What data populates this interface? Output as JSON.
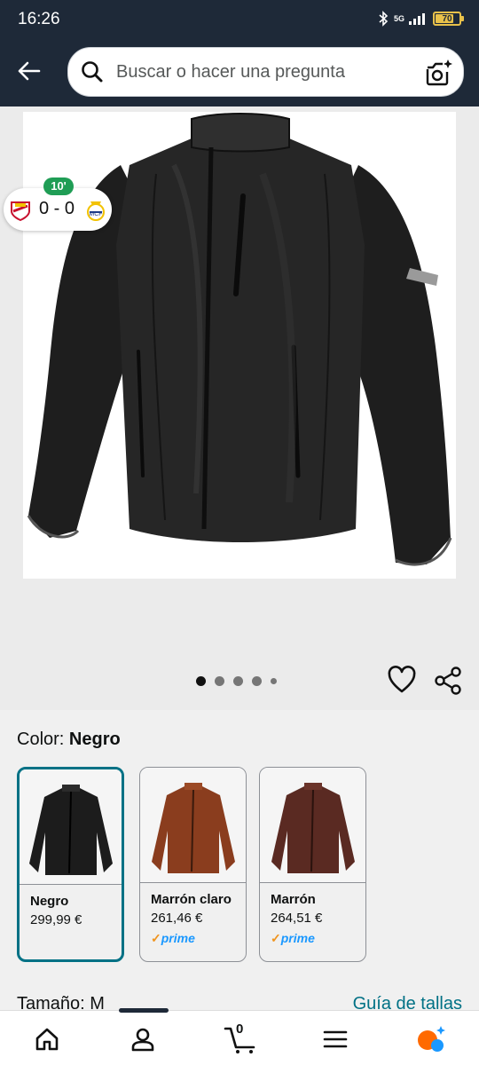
{
  "status_bar": {
    "time": "16:26",
    "network": "5G",
    "battery": "70"
  },
  "search": {
    "placeholder": "Buscar o hacer una pregunta"
  },
  "score_widget": {
    "minute": "10'",
    "score": "0 - 0"
  },
  "gallery": {
    "image_count": 5,
    "active_index": 0
  },
  "variations": {
    "color_prefix": "Color: ",
    "color_value": "Negro",
    "options": [
      {
        "name": "Negro",
        "price": "299,99 €",
        "prime": false,
        "selected": true,
        "color": "#1c1c1c"
      },
      {
        "name": "Marrón claro",
        "price": "261,46 €",
        "prime": true,
        "selected": false,
        "color": "#8a3d1e"
      },
      {
        "name": "Marrón",
        "price": "264,51 €",
        "prime": true,
        "selected": false,
        "color": "#5a2a22"
      }
    ],
    "prime_label": "prime"
  },
  "size": {
    "label": "Tamaño: M",
    "guide_link": "Guía de tallas"
  },
  "bottom_nav": {
    "cart_count": "0"
  },
  "colors": {
    "header_bg": "#1e2938",
    "link": "#007185",
    "selected_border": "#007185",
    "prime_blue": "#1a98ff"
  }
}
